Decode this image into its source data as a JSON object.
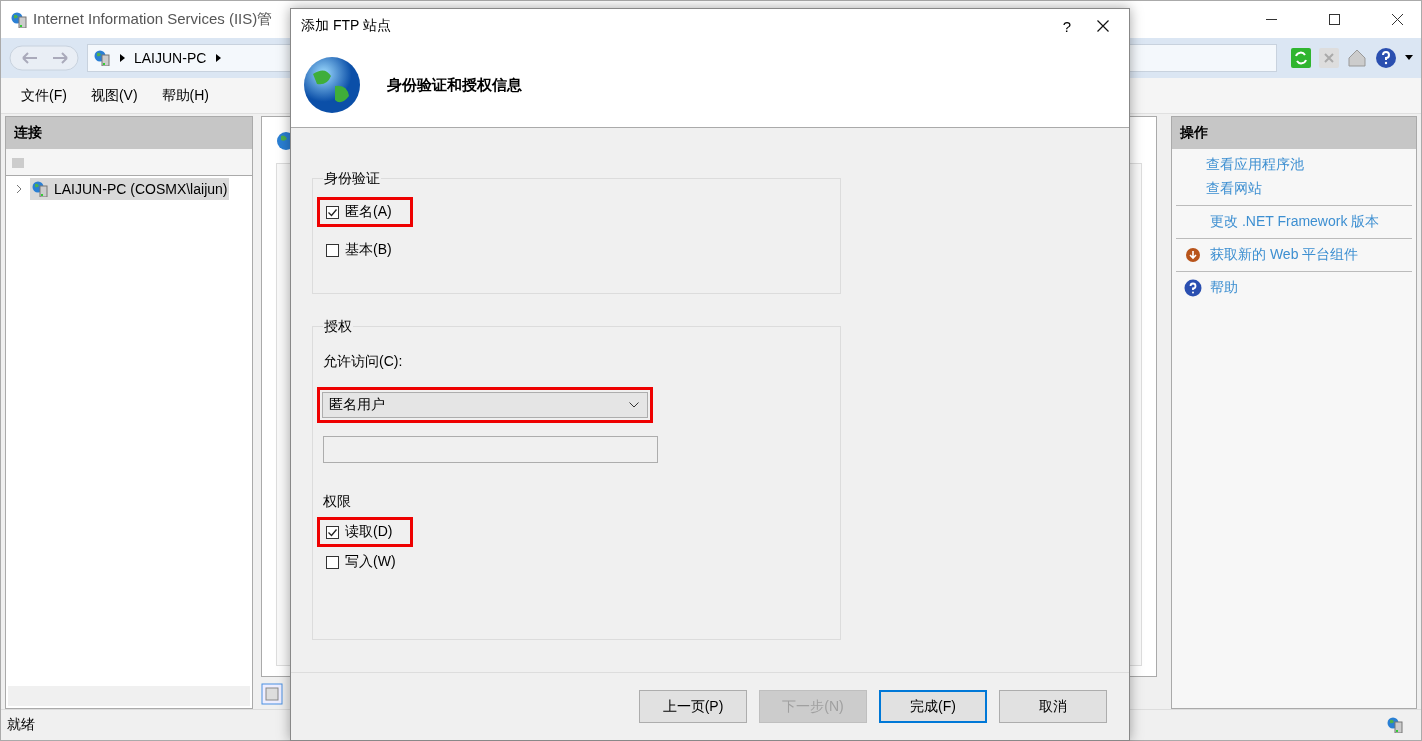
{
  "window": {
    "title": "Internet Information Services (IIS)管"
  },
  "address_bar": {
    "crumbs": [
      "LAIJUN-PC"
    ]
  },
  "menu": [
    "文件(F)",
    "视图(V)",
    "帮助(H)"
  ],
  "connections": {
    "title": "连接",
    "tree": [
      {
        "label": "LAIJUN-PC (COSMX\\laijun)",
        "selected": true,
        "expanded": false
      }
    ]
  },
  "actions": {
    "title": "操作",
    "groups": [
      {
        "items": [
          {
            "label": "查看应用程序池",
            "kind": "link"
          },
          {
            "label": "查看网站",
            "kind": "link"
          }
        ]
      },
      {
        "items": [
          {
            "label": "更改 .NET Framework 版本",
            "kind": "link"
          }
        ]
      },
      {
        "items": [
          {
            "label": "获取新的 Web 平台组件",
            "kind": "download"
          }
        ]
      },
      {
        "items": [
          {
            "label": "帮助",
            "kind": "help"
          }
        ]
      }
    ]
  },
  "status_bar": {
    "text": "就绪"
  },
  "dialog": {
    "title": "添加 FTP 站点",
    "help": "?",
    "heading": "身份验证和授权信息",
    "authentication": {
      "title": "身份验证",
      "options": [
        {
          "label": "匿名(A)",
          "checked": true,
          "highlighted": true
        },
        {
          "label": "基本(B)",
          "checked": false,
          "highlighted": false
        }
      ]
    },
    "authorization": {
      "title": "授权",
      "access_label": "允许访问(C):",
      "access": {
        "value": "匿名用户",
        "highlighted": true
      },
      "permissions_label": "权限",
      "permissions": [
        {
          "label": "读取(D)",
          "checked": true,
          "highlighted": true
        },
        {
          "label": "写入(W)",
          "checked": false,
          "highlighted": false
        }
      ]
    },
    "buttons": [
      {
        "label": "上一页(P)",
        "disabled": false,
        "default": false
      },
      {
        "label": "下一步(N)",
        "disabled": true,
        "default": false
      },
      {
        "label": "完成(F)",
        "disabled": false,
        "default": true
      },
      {
        "label": "取消",
        "disabled": false,
        "default": false
      }
    ]
  }
}
